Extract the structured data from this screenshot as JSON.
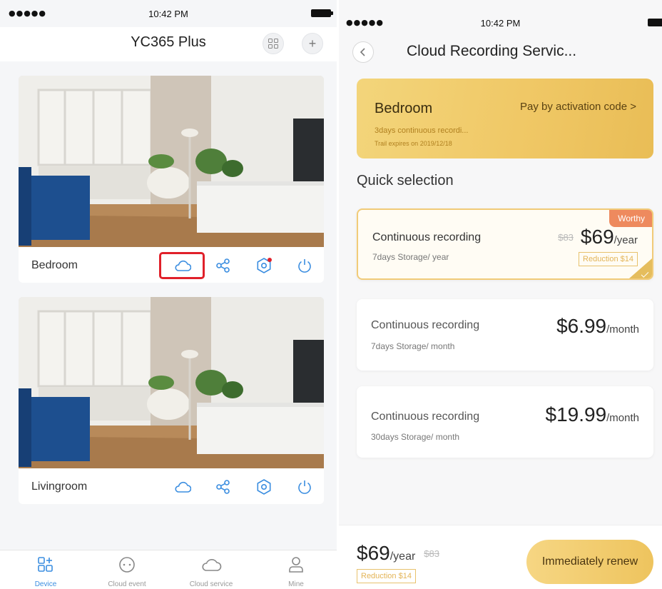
{
  "left_screen": {
    "status": {
      "signal": "●●●●● ",
      "time": "10:42 PM"
    },
    "header": {
      "title": "YC365 Plus"
    },
    "devices": [
      {
        "name": "Bedroom"
      },
      {
        "name": "Livingroom"
      }
    ],
    "tabs": [
      {
        "label": "Device",
        "icon": "device-grid-icon",
        "active": true
      },
      {
        "label": "Cloud event",
        "icon": "cloud-event-icon",
        "active": false
      },
      {
        "label": "Cloud service",
        "icon": "cloud-icon",
        "active": false
      },
      {
        "label": "Mine",
        "icon": "user-icon",
        "active": false
      }
    ],
    "colors": {
      "accent": "#3a8de0",
      "highlight": "#e0202a"
    }
  },
  "right_screen": {
    "status": {
      "signal": "●●●●● ",
      "time": "10:42 PM"
    },
    "page_title": "Cloud Recording Servic...",
    "banner": {
      "device": "Bedroom",
      "pay_link": "Pay by activation code >",
      "description": "3days continuous recordi...",
      "trial": "Trail expires on 2019/12/18"
    },
    "quick_selection_title": "Quick selection",
    "plans": [
      {
        "name": "Continuous recording",
        "storage": "7days Storage/ year",
        "original_price": "$83",
        "price": "$69",
        "unit": "/year",
        "badge": "Worthy",
        "reduction": "Reduction $14",
        "selected": true
      },
      {
        "name": "Continuous recording",
        "storage": "7days Storage/ month",
        "price": "$6.99",
        "unit": "/month",
        "selected": false
      },
      {
        "name": "Continuous recording",
        "storage": "30days Storage/ month",
        "price": "$19.99",
        "unit": "/month",
        "selected": false
      }
    ],
    "footer": {
      "price": "$69",
      "unit": "/year",
      "original_price": "$83",
      "reduction": "Reduction $14",
      "renew_label": "Immediately renew"
    },
    "colors": {
      "gold": "#f0c866",
      "badge": "#ee8a5e"
    }
  }
}
